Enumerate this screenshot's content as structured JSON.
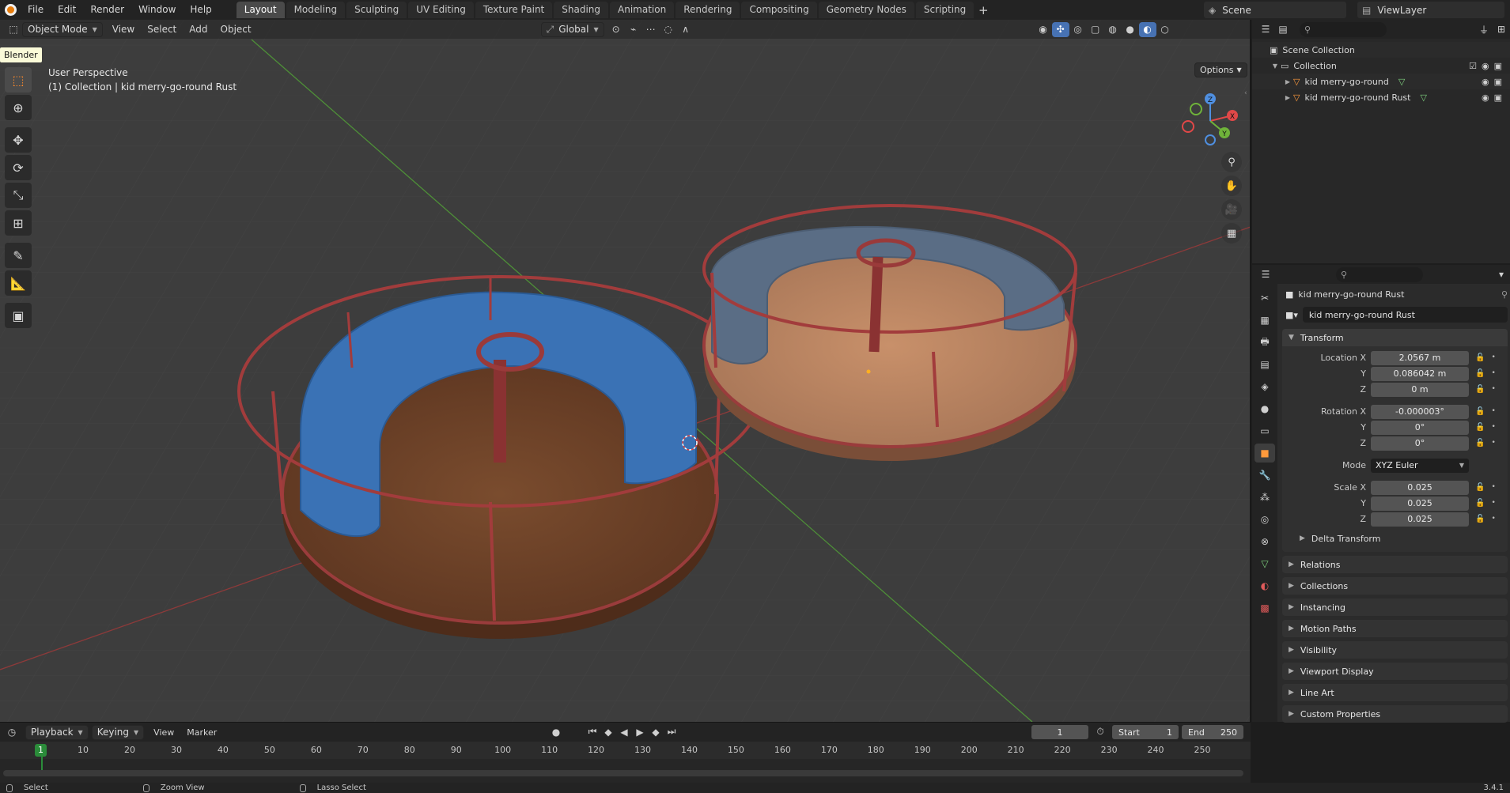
{
  "topbar": {
    "menus": [
      "File",
      "Edit",
      "Render",
      "Window",
      "Help"
    ],
    "workspaces": [
      "Layout",
      "Modeling",
      "Sculpting",
      "UV Editing",
      "Texture Paint",
      "Shading",
      "Animation",
      "Rendering",
      "Compositing",
      "Geometry Nodes",
      "Scripting"
    ],
    "active_workspace": "Layout",
    "add_tab": "+",
    "scene": "Scene",
    "view_layer": "ViewLayer"
  },
  "tooltip": "Blender",
  "viewport": {
    "mode": "Object Mode",
    "menus": [
      "View",
      "Select",
      "Add",
      "Object"
    ],
    "orientation": "Global",
    "options_label": "Options",
    "info_line1": "User Perspective",
    "info_line2": "(1) Collection | kid merry-go-round Rust",
    "gizmo_axes": [
      "X",
      "Y",
      "Z"
    ]
  },
  "outliner": {
    "rows": [
      {
        "label": "Scene Collection",
        "indent": 0
      },
      {
        "label": "Collection",
        "indent": 1
      },
      {
        "label": "kid merry-go-round",
        "indent": 2
      },
      {
        "label": "kid merry-go-round Rust",
        "indent": 2
      }
    ]
  },
  "properties": {
    "object_name": "kid merry-go-round Rust",
    "object_name_field": "kid merry-go-round Rust",
    "transform_title": "Transform",
    "location": {
      "label": "Location X",
      "x": "2.0567 m",
      "y": "0.086042 m",
      "z": "0 m"
    },
    "rotation": {
      "label": "Rotation X",
      "x": "-0.000003°",
      "y": "0°",
      "z": "0°"
    },
    "mode_label": "Mode",
    "mode_value": "XYZ Euler",
    "scale": {
      "label": "Scale X",
      "x": "0.025",
      "y": "0.025",
      "z": "0.025"
    },
    "axis_y": "Y",
    "axis_z": "Z",
    "delta_transform": "Delta Transform",
    "closed_panels": [
      "Relations",
      "Collections",
      "Instancing",
      "Motion Paths",
      "Visibility",
      "Viewport Display",
      "Line Art",
      "Custom Properties"
    ]
  },
  "timeline": {
    "menus": [
      "Playback",
      "Keying",
      "View",
      "Marker"
    ],
    "current_frame": "1",
    "start_label": "Start",
    "start": "1",
    "end_label": "End",
    "end": "250",
    "ticks": [
      1,
      10,
      20,
      30,
      40,
      50,
      60,
      70,
      80,
      90,
      100,
      110,
      120,
      130,
      140,
      150,
      160,
      170,
      180,
      190,
      200,
      210,
      220,
      230,
      240,
      250
    ]
  },
  "statusbar": {
    "items": [
      "Select",
      "Zoom View",
      "Lasso Select"
    ],
    "version": "3.4.1"
  },
  "colors": {
    "accent": "#4772b3",
    "active_tool": "#ff8a2a",
    "playhead": "#2b8c3a",
    "x_axis": "#e04848",
    "y_axis": "#6fb33a",
    "z_axis": "#4f8fe0"
  }
}
